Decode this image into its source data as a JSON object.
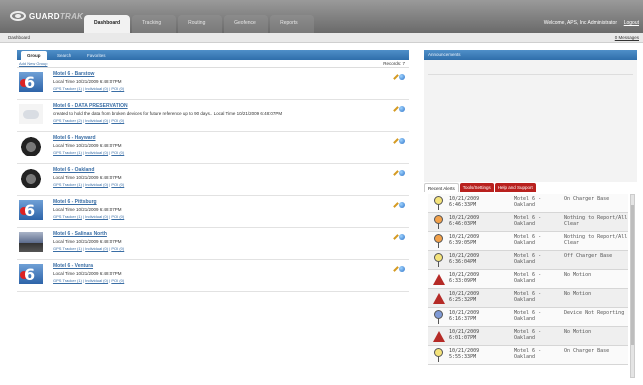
{
  "app": {
    "logo_main": "GUARD",
    "logo_accent": "TRAK",
    "tabs": [
      "Dashboard",
      "Tracking",
      "Routing",
      "Geofence",
      "Reports"
    ],
    "welcome": "Welcome, APS, Inc Administrator",
    "logout": "Logout"
  },
  "subbar": {
    "breadcrumb": "Dashboard",
    "messages": "0 Messages"
  },
  "left": {
    "subtabs": [
      "Group",
      "Search",
      "Favorites"
    ],
    "add_group": "Add New Group",
    "records": "Records: 7",
    "rows": [
      {
        "title": "Motel 6 - Barstow",
        "line": "Local Time 10/21/2009 6:48:07PM",
        "links": [
          "GPS Tracker (1)",
          "Individual (0)",
          "POI (0)"
        ],
        "thumb": "motel"
      },
      {
        "title": "Motel 6 - DATA PRESERVATION",
        "line": "created to hold the data from broken devices for future reference up to 90 days.. Local Time 10/21/2009 6:48:07PM",
        "links": [
          "GPS Tracker (2)",
          "Individual (0)",
          "POI (0)"
        ],
        "thumb": "cloud"
      },
      {
        "title": "Motel 6 - Hayward",
        "line": "Local Time 10/21/2009 6:48:07PM",
        "links": [
          "GPS Tracker (1)",
          "Individual (0)",
          "POI (0)"
        ],
        "thumb": "car"
      },
      {
        "title": "Motel 6 - Oakland",
        "line": "Local Time 10/21/2009 6:48:07PM",
        "links": [
          "GPS Tracker (1)",
          "Individual (0)",
          "POI (0)"
        ],
        "thumb": "car"
      },
      {
        "title": "Motel 6 - Pittsburg",
        "line": "Local Time 10/21/2009 6:48:07PM",
        "links": [
          "GPS Tracker (1)",
          "Individual (0)",
          "POI (0)"
        ],
        "thumb": "motel"
      },
      {
        "title": "Motel 6 - Salinas North",
        "line": "Local Time 10/21/2009 6:48:07PM",
        "links": [
          "GPS Tracker (1)",
          "Individual (0)",
          "POI (0)"
        ],
        "thumb": "car2"
      },
      {
        "title": "Motel 6 - Ventura",
        "line": "Local Time 10/21/2009 6:48:07PM",
        "links": [
          "GPS Tracker (1)",
          "Individual (0)",
          "POI (0)"
        ],
        "thumb": "motel"
      }
    ]
  },
  "map": {
    "title": "Announcements"
  },
  "alerts": {
    "tabs": [
      "Recent Alerts",
      "Tools/Settings",
      "Help and Support"
    ],
    "items": [
      {
        "date": "10/21/2009",
        "time": "6:46:33PM",
        "loc1": "Motel 6 -",
        "loc2": "Oakland",
        "status1": "On Charger Base",
        "status2": "",
        "icon": "pin",
        "color": "#f4e37a"
      },
      {
        "date": "10/21/2009",
        "time": "6:46:03PM",
        "loc1": "Motel 6 -",
        "loc2": "Oakland",
        "status1": "Nothing to Report/All",
        "status2": "Clear",
        "icon": "pin",
        "color": "#f2a14a"
      },
      {
        "date": "10/21/2009",
        "time": "6:39:05PM",
        "loc1": "Motel 6 -",
        "loc2": "Oakland",
        "status1": "Nothing to Report/All",
        "status2": "Clear",
        "icon": "pin",
        "color": "#f2a14a"
      },
      {
        "date": "10/21/2009",
        "time": "6:36:04PM",
        "loc1": "Motel 6 -",
        "loc2": "Oakland",
        "status1": "Off Charger Base",
        "status2": "",
        "icon": "pin",
        "color": "#f4e37a"
      },
      {
        "date": "10/21/2009",
        "time": "6:33:09PM",
        "loc1": "Motel 6 -",
        "loc2": "Oakland",
        "status1": "No Motion",
        "status2": "",
        "icon": "tri",
        "color": "#b52a26"
      },
      {
        "date": "10/21/2009",
        "time": "6:25:32PM",
        "loc1": "Motel 6 -",
        "loc2": "Oakland",
        "status1": "No Motion",
        "status2": "",
        "icon": "tri",
        "color": "#b52a26"
      },
      {
        "date": "10/21/2009",
        "time": "6:16:37PM",
        "loc1": "Motel 6 -",
        "loc2": "Oakland",
        "status1": "Device Not Reporting",
        "status2": "",
        "icon": "pin",
        "color": "#7f9ad6"
      },
      {
        "date": "10/21/2009",
        "time": "6:01:07PM",
        "loc1": "Motel 6 -",
        "loc2": "Oakland",
        "status1": "No Motion",
        "status2": "",
        "icon": "tri",
        "color": "#b52a26"
      },
      {
        "date": "10/21/2009",
        "time": "5:55:33PM",
        "loc1": "Motel 6 -",
        "loc2": "Oakland",
        "status1": "On Charger Base",
        "status2": "",
        "icon": "pin",
        "color": "#f4e37a"
      }
    ]
  }
}
